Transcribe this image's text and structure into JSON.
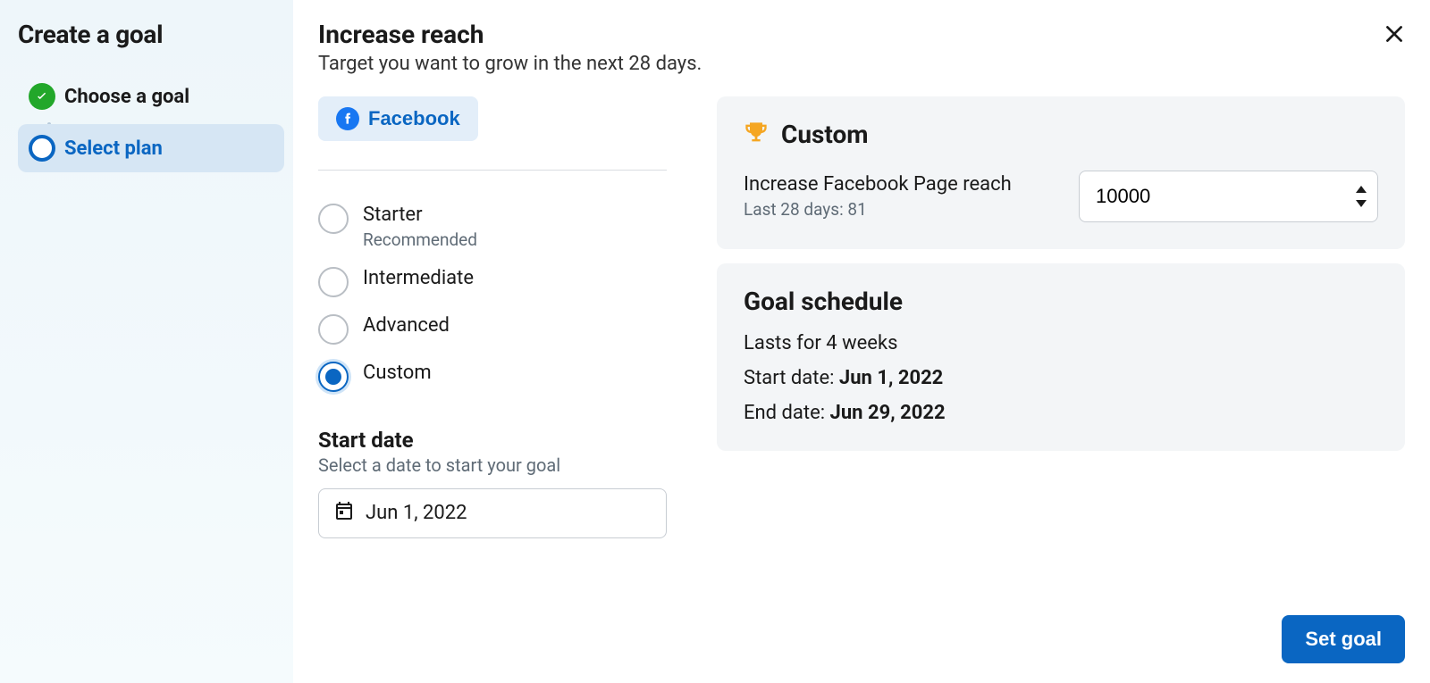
{
  "sidebar": {
    "title": "Create a goal",
    "steps": [
      {
        "label": "Choose a goal",
        "status": "completed"
      },
      {
        "label": "Select plan",
        "status": "current"
      }
    ]
  },
  "header": {
    "title": "Increase reach",
    "subtitle": "Target you want to grow in the next 28 days."
  },
  "platform": {
    "label": "Facebook"
  },
  "plans": [
    {
      "label": "Starter",
      "sub": "Recommended",
      "selected": false
    },
    {
      "label": "Intermediate",
      "sub": "",
      "selected": false
    },
    {
      "label": "Advanced",
      "sub": "",
      "selected": false
    },
    {
      "label": "Custom",
      "sub": "",
      "selected": true
    }
  ],
  "start_date": {
    "heading": "Start date",
    "sub": "Select a date to start your goal",
    "value": "Jun 1, 2022"
  },
  "custom_card": {
    "title": "Custom",
    "metric_label": "Increase Facebook Page reach",
    "metric_sub": "Last 28 days: 81",
    "input_value": "10000"
  },
  "schedule_card": {
    "title": "Goal schedule",
    "duration": "Lasts for 4 weeks",
    "start_label": "Start date: ",
    "start_value": "Jun 1, 2022",
    "end_label": "End date: ",
    "end_value": "Jun 29, 2022"
  },
  "footer": {
    "primary": "Set goal"
  }
}
